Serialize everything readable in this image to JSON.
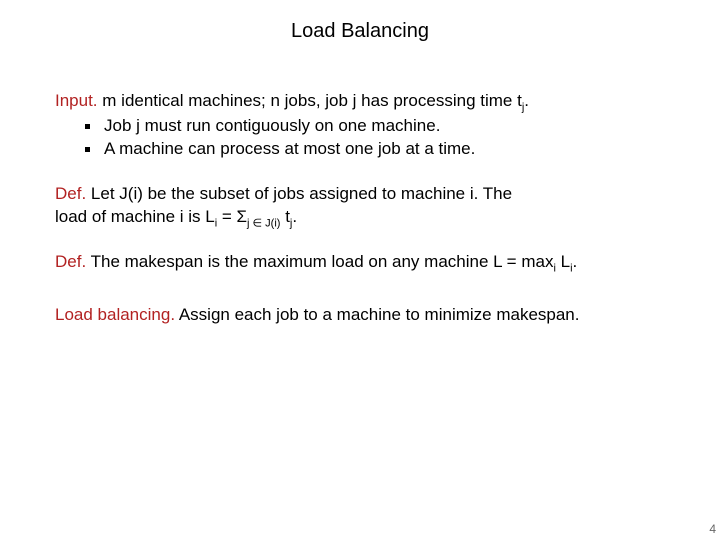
{
  "title": "Load Balancing",
  "input": {
    "lead": "Input.",
    "text": "m identical machines; n jobs, job j has processing time t",
    "sub": "j",
    "tail": ".",
    "bullets": [
      "Job j must run contiguously on one machine.",
      "A machine can process at most one job at a time."
    ]
  },
  "def1": {
    "lead": "Def.",
    "line1": "Let J(i) be the subset of jobs assigned to machine i.  The",
    "line2a": "load of machine i is L",
    "line2a_sub": "i",
    "line2b": " = Σ",
    "line2b_sub": "j ∈ J(i)",
    "line2c": " t",
    "line2c_sub": "j",
    "line2d": "."
  },
  "def2": {
    "lead": "Def.",
    "a": "The makespan is the maximum load on any machine L = max",
    "a_sub": "i",
    "b": " L",
    "b_sub": "i",
    "c": "."
  },
  "lb": {
    "lead": "Load balancing.",
    "text": "Assign each job to a machine to minimize makespan."
  },
  "page": "4"
}
